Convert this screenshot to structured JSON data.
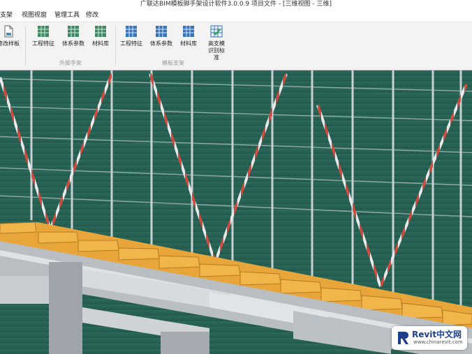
{
  "window": {
    "title": "广联达BIM模板脚手架设计软件3.0.0.9 项目文件 - [三维视图 - 三维]"
  },
  "menu": [
    "支架",
    "视图视窗",
    "管理工具",
    "修改"
  ],
  "ribbon": {
    "first_button": {
      "label": "修改样板",
      "icon": "document-icon"
    },
    "groups": [
      {
        "label": "外脚手架",
        "buttons": [
          {
            "label": "工程特征",
            "icon": "project-grid-icon"
          },
          {
            "label": "体系参数",
            "icon": "parameter-grid-icon"
          },
          {
            "label": "材料库",
            "icon": "material-grid-icon"
          }
        ]
      },
      {
        "label": "模板支架",
        "buttons": [
          {
            "label": "工程特征",
            "icon": "project-grid-icon"
          },
          {
            "label": "体系参数",
            "icon": "parameter-grid-icon"
          },
          {
            "label": "材料库",
            "icon": "material-grid-icon"
          },
          {
            "label": "高支模识别标准",
            "icon": "check-grid-icon"
          }
        ]
      }
    ]
  },
  "watermark": {
    "name": "Revit中文网",
    "url": "www.chinarevit.com"
  },
  "colors": {
    "net": "#2f6f5f",
    "board": "#e8a63a",
    "beam": "#c9cdd1",
    "brace_red": "#c0392b"
  }
}
